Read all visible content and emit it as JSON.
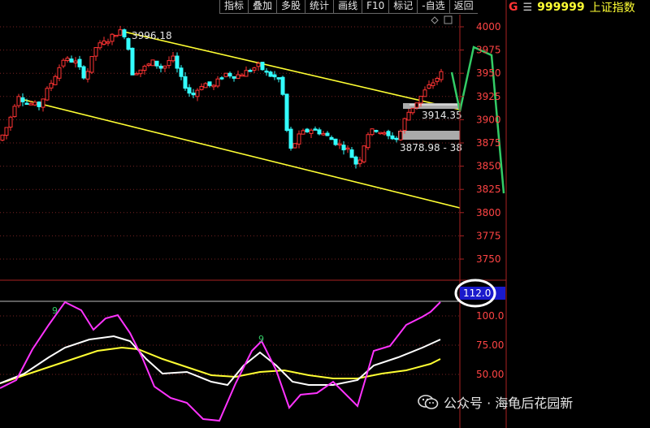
{
  "toolbar": {
    "buttons": [
      "指标",
      "叠加",
      "多股",
      "统计",
      "画线",
      "F10",
      "标记",
      "-自选",
      "返回"
    ]
  },
  "quote": {
    "marker": "G",
    "code": "999999",
    "name": "上证指数"
  },
  "watermark": {
    "text": "公众号 · 海龟后花园新"
  },
  "chart_data": [
    {
      "type": "candlestick",
      "up_color": "#ff3333",
      "down_color": "#33ffff",
      "trendline_color": "#ffff33",
      "projection_color": "#33cc66",
      "y_axis_ticks": [
        "4000",
        "3975",
        "3950",
        "3925",
        "3900",
        "3875",
        "3850",
        "3825",
        "3800",
        "3775",
        "3750"
      ],
      "ylim": [
        3725,
        4025
      ],
      "grid": "dotted horizontal",
      "price_annotations": [
        {
          "label": "3996.18",
          "value": 3996.18
        },
        {
          "label": "3914.35",
          "value": 3914.35
        },
        {
          "label": "3878.98 - 38",
          "value": 3878.98
        }
      ]
    },
    {
      "type": "line",
      "series_colors": [
        "#ff33ff",
        "#ffffff",
        "#ffff33"
      ],
      "y_axis_ticks": [
        "100.0",
        "75.00",
        "50.00"
      ],
      "ylim": [
        20,
        125
      ],
      "current_value_label": "112.0",
      "point_labels": [
        "9",
        "9"
      ]
    }
  ]
}
